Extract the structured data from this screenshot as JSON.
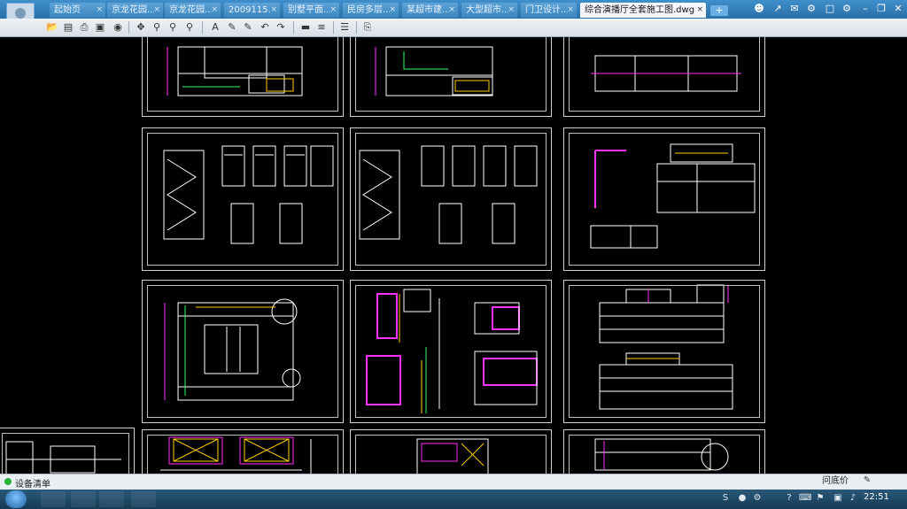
{
  "tabs": [
    {
      "label": "起始页"
    },
    {
      "label": "京龙花园..."
    },
    {
      "label": "京龙花园..."
    },
    {
      "label": "2009115..."
    },
    {
      "label": "别墅平面..."
    },
    {
      "label": "民房多层..."
    },
    {
      "label": "某超市建..."
    },
    {
      "label": "大型超市..."
    },
    {
      "label": "门卫设计..."
    }
  ],
  "active_tab": {
    "label": "综合演播厅全套施工图.dwg"
  },
  "tab_close_glyph": "×",
  "new_tab_glyph": "+",
  "window_icons": [
    "user-group-icon",
    "share-icon",
    "message-icon",
    "settings-icon",
    "phone-icon",
    "gear-icon",
    "minimize-icon",
    "restore-icon",
    "close-icon"
  ],
  "toolbar_icons": [
    "open-icon",
    "save-icon",
    "print-icon",
    "export-pdf-icon",
    "lock-icon",
    "pan-icon",
    "zoom-in-icon",
    "zoom-window-icon",
    "zoom-extents-icon",
    "text-icon",
    "pen-icon",
    "highlighter-icon",
    "undo-icon",
    "redo-icon",
    "measure-icon",
    "layer-icon",
    "layers-stack-icon",
    "markup-icon"
  ],
  "status": {
    "label": "设备清单"
  },
  "tray": {
    "help": "问底价",
    "clock": "22:51"
  },
  "colors": {
    "canvas": "#000000",
    "line": "#ffffff",
    "accent_magenta": "#ff33ff",
    "accent_yellow": "#ffcc00",
    "accent_green": "#33ff66",
    "tab_active": "#f5f8fb"
  }
}
